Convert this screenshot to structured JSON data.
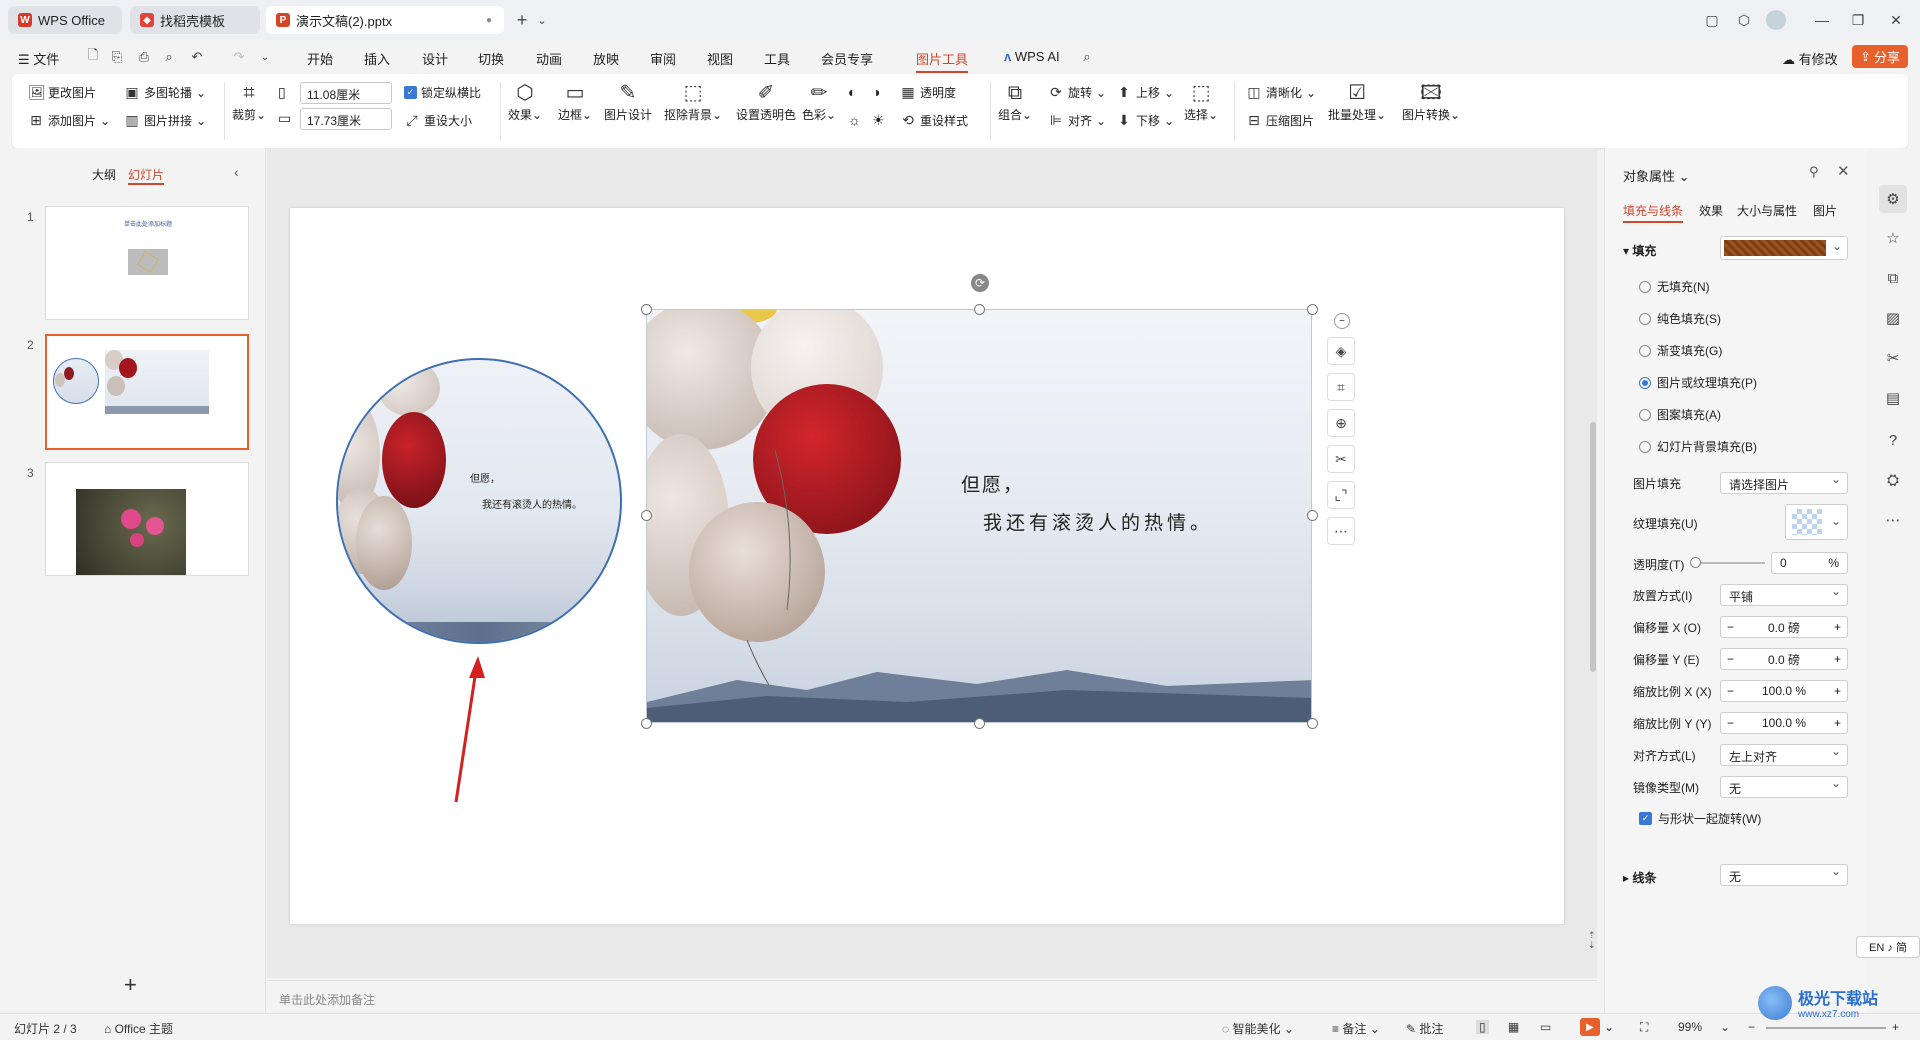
{
  "tabs": [
    {
      "label": "WPS Office",
      "icon": "wps-logo-icon"
    },
    {
      "label": "找稻壳模板",
      "icon": "daoke-icon"
    },
    {
      "label": "演示文稿(2).pptx",
      "icon": "ppt-file-icon"
    }
  ],
  "menu": {
    "file": "文件",
    "items": [
      "开始",
      "插入",
      "设计",
      "切换",
      "动画",
      "放映",
      "审阅",
      "视图",
      "工具",
      "会员专享",
      "图片工具"
    ],
    "active": "图片工具",
    "wps_ai": "WPS AI",
    "modified": "有修改",
    "share": "分享"
  },
  "ribbon": {
    "change_image": "更改图片",
    "multi_outline": "多图轮播",
    "add_image": "添加图片",
    "image_collage": "图片拼接",
    "crop": "裁剪",
    "width_value": "11.08厘米",
    "height_value": "17.73厘米",
    "lock_ratio": "锁定纵横比",
    "reset_size": "重设大小",
    "effects": "效果",
    "border": "边框",
    "image_design": "图片设计",
    "remove_bg": "抠除背景",
    "set_transparent": "设置透明色",
    "color": "色彩",
    "transparency": "透明度",
    "reset_style": "重设样式",
    "group": "组合",
    "rotate": "旋转",
    "align": "对齐",
    "move_up": "上移",
    "move_down": "下移",
    "select": "选择",
    "sharpen": "清晰化",
    "compress": "压缩图片",
    "batch": "批量处理",
    "convert": "图片转换"
  },
  "left_panel": {
    "outline_tab": "大纲",
    "slides_tab": "幻灯片",
    "slide_numbers": [
      "1",
      "2",
      "3"
    ],
    "slide1_title": "单击此处添加标题"
  },
  "slide": {
    "poem_line1": "但愿，",
    "poem_line2": "我还有滚烫人的热情。"
  },
  "notes_placeholder": "单击此处添加备注",
  "right_panel": {
    "title": "对象属性",
    "tabs": [
      "填充与线条",
      "效果",
      "大小与属性",
      "图片"
    ],
    "fill_section": "填充",
    "fill_options": [
      "无填充(N)",
      "纯色填充(S)",
      "渐变填充(G)",
      "图片或纹理填充(P)",
      "图案填充(A)",
      "幻灯片背景填充(B)"
    ],
    "selected_fill": 3,
    "picture_fill_label": "图片填充",
    "picture_fill_value": "请选择图片",
    "texture_fill_label": "纹理填充(U)",
    "transparency_label": "透明度(T)",
    "transparency_value": "0",
    "transparency_unit": "%",
    "placement_label": "放置方式(I)",
    "placement_value": "平铺",
    "offset_x_label": "偏移量 X (O)",
    "offset_x_value": "0.0",
    "offset_y_label": "偏移量 Y (E)",
    "offset_y_value": "0.0",
    "offset_unit": "磅",
    "scale_x_label": "缩放比例 X (X)",
    "scale_x_value": "100.0",
    "scale_y_label": "缩放比例 Y (Y)",
    "scale_y_value": "100.0",
    "scale_unit": "%",
    "align_label": "对齐方式(L)",
    "align_value": "左上对齐",
    "mirror_label": "镜像类型(M)",
    "mirror_value": "无",
    "rotate_with_shape": "与形状一起旋转(W)",
    "line_section": "线条",
    "line_value": "无"
  },
  "status": {
    "slide_info": "幻灯片 2 / 3",
    "theme": "Office 主题",
    "beautify": "智能美化",
    "notes": "备注",
    "comments": "批注",
    "zoom": "99%",
    "ime": "EN ♪ 简"
  },
  "watermark": "极光下载站",
  "watermark_url": "www.xz7.com",
  "colors": {
    "accent": "#d0492f",
    "share_bg": "#e8612c",
    "selected_blue": "#3a78d6",
    "arrow_red": "#d42020"
  }
}
